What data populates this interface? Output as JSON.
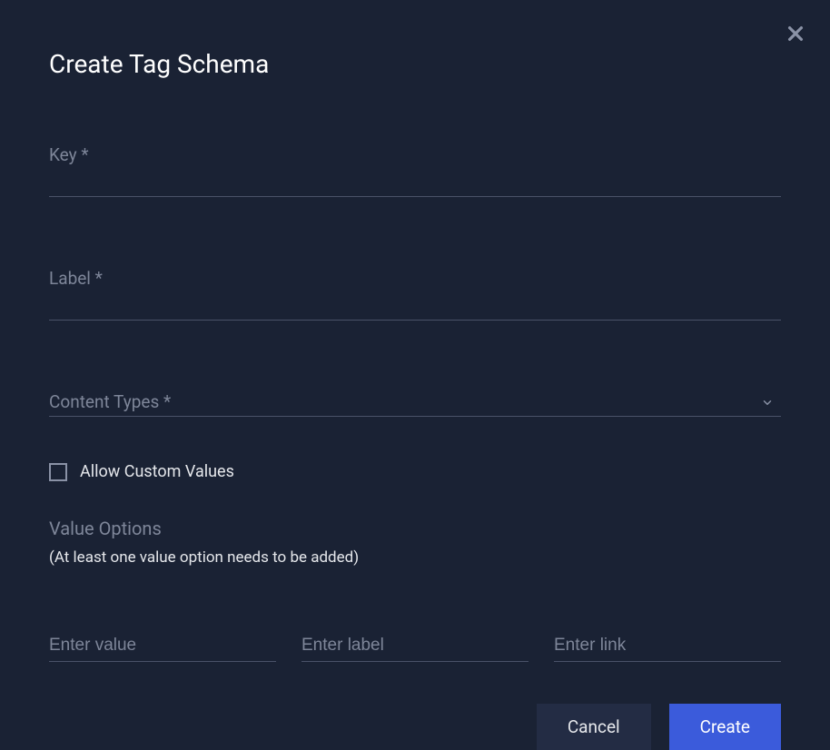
{
  "modal": {
    "title": "Create Tag Schema"
  },
  "fields": {
    "key": {
      "label": "Key *",
      "value": ""
    },
    "label": {
      "label": "Label *",
      "value": ""
    },
    "content_types": {
      "label": "Content Types *",
      "value": ""
    }
  },
  "checkbox": {
    "allow_custom": {
      "label": "Allow Custom Values",
      "checked": false
    }
  },
  "value_options": {
    "heading": "Value Options",
    "hint": "(At least one value option needs to be added)",
    "row": {
      "value_placeholder": "Enter value",
      "label_placeholder": "Enter label",
      "link_placeholder": "Enter link"
    }
  },
  "buttons": {
    "cancel": "Cancel",
    "create": "Create"
  }
}
